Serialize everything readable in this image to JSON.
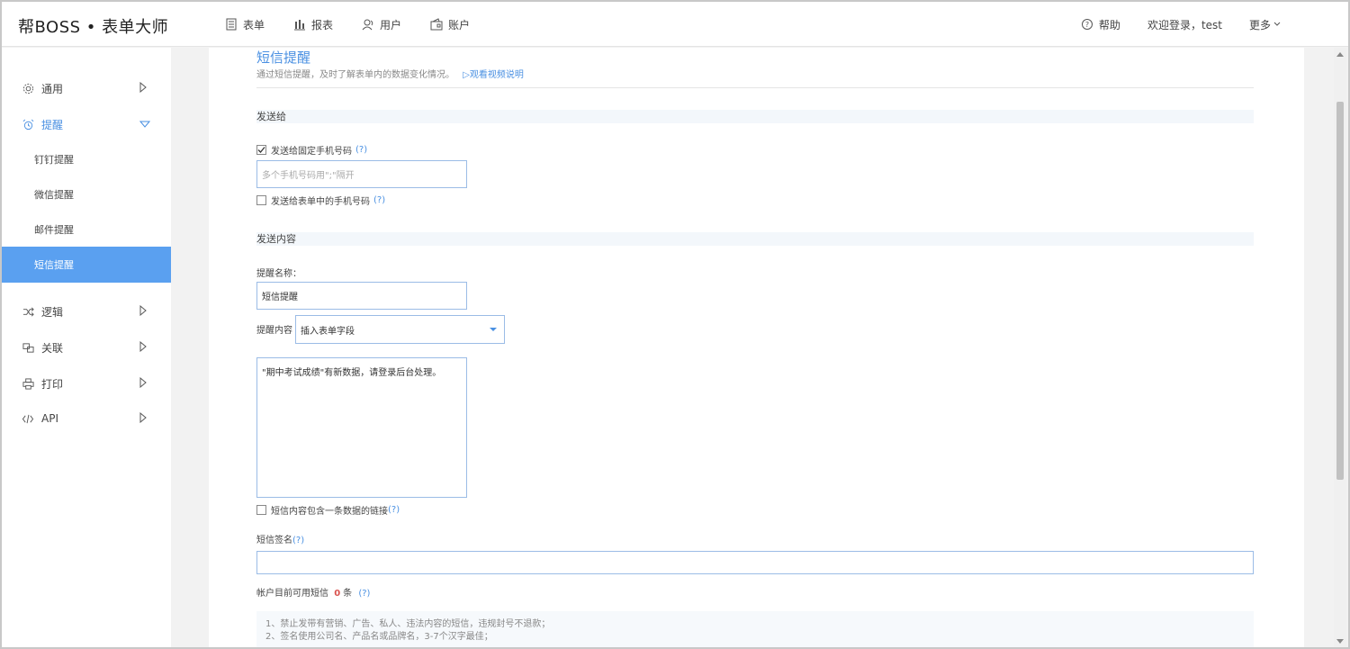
{
  "header": {
    "logo": "帮BOSS • 表单大师",
    "nav": [
      {
        "label": "表单",
        "icon": "form-icon"
      },
      {
        "label": "报表",
        "icon": "chart-icon"
      },
      {
        "label": "用户",
        "icon": "user-icon"
      },
      {
        "label": "账户",
        "icon": "wallet-icon"
      }
    ],
    "help": "帮助",
    "welcome": "欢迎登录，test",
    "more": "更多"
  },
  "sidebar": {
    "items": [
      {
        "label": "通用",
        "icon": "gear-icon"
      },
      {
        "label": "提醒",
        "icon": "alarm-icon"
      },
      {
        "label": "逻辑",
        "icon": "shuffle-icon"
      },
      {
        "label": "关联",
        "icon": "link-icon"
      },
      {
        "label": "打印",
        "icon": "printer-icon"
      },
      {
        "label": "API",
        "icon": "code-icon"
      }
    ],
    "sub_items": [
      "钉钉提醒",
      "微信提醒",
      "邮件提醒",
      "短信提醒"
    ],
    "active_sub": "短信提醒"
  },
  "main": {
    "title": "短信提醒",
    "description": "通过短信提醒，及时了解表单内的数据变化情况。",
    "video_link": "观看视频说明",
    "section_send_to": "发送给",
    "fixed_phone_checkbox": "发送给固定手机号码",
    "fixed_phone_checked": true,
    "phone_placeholder": "多个手机号码用\";\"隔开",
    "form_phone_checkbox": "发送给表单中的手机号码",
    "section_content": "发送内容",
    "reminder_name_label": "提醒名称：",
    "reminder_name_value": "短信提醒",
    "reminder_content_label": "提醒内容",
    "insert_field_select": "插入表单字段",
    "message_text": "\"期中考试成绩\"有新数据，请登录后台处理。",
    "include_link_checkbox": "短信内容包含一条数据的链接",
    "signature_label": "短信签名",
    "signature_value": "",
    "balance_prefix": "帐户目前可用短信",
    "balance_count": "0",
    "balance_suffix": "条",
    "help_mark": "(?)",
    "notices": [
      "1、禁止发带有营销、广告、私人、违法内容的短信，违规封号不退款；",
      "2、签名使用公司名、产品名或品牌名，3-7个汉字最佳；"
    ]
  },
  "colors": {
    "accent": "#4a90e2",
    "active_bg": "#5aa0f0",
    "balance": "#d9534f"
  }
}
